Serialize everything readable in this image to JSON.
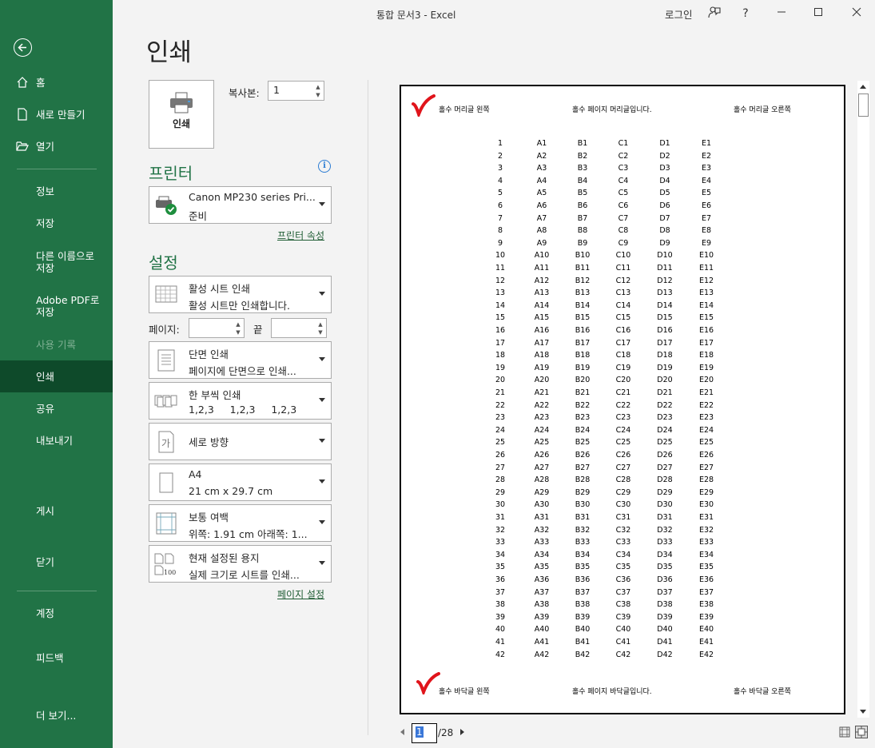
{
  "window": {
    "title": "통합 문서3  -  Excel",
    "login": "로그인",
    "help": "?"
  },
  "sidebar": {
    "items": [
      {
        "label": "홈"
      },
      {
        "label": "새로 만들기"
      },
      {
        "label": "열기"
      },
      {
        "label": "정보"
      },
      {
        "label": "저장"
      },
      {
        "label": "다른 이름으로\n저장"
      },
      {
        "label": "Adobe PDF로\n저장"
      },
      {
        "label": "사용 기록"
      },
      {
        "label": "인쇄"
      },
      {
        "label": "공유"
      },
      {
        "label": "내보내기"
      },
      {
        "label": "게시"
      },
      {
        "label": "닫기"
      },
      {
        "label": "계정"
      },
      {
        "label": "피드백"
      },
      {
        "label": "더 보기..."
      }
    ]
  },
  "print": {
    "title": "인쇄",
    "print_button": "인쇄",
    "copies_label": "복사본:",
    "copies_value": "1",
    "printer_section": "프린터",
    "printer_name": "Canon MP230 series Pri...",
    "printer_status": "준비",
    "printer_props": "프린터 속성",
    "settings_section": "설정",
    "pages_label": "페이지:",
    "end_label": "끝",
    "page_setup": "페이지 설정",
    "settings": [
      {
        "l1": "활성 시트 인쇄",
        "l2": "활성 시트만 인쇄합니다."
      },
      {
        "l1": "단면 인쇄",
        "l2": "페이지에 단면으로 인쇄..."
      },
      {
        "l1": "한 부씩 인쇄",
        "l2": "1,2,3     1,2,3     1,2,3"
      },
      {
        "l1": "세로 방향",
        "l2": ""
      },
      {
        "l1": "A4",
        "l2": "21 cm x 29.7 cm"
      },
      {
        "l1": "보통 여백",
        "l2": "위쪽: 1.91 cm 아래쪽: 1..."
      },
      {
        "l1": "현재 설정된 용지",
        "l2": "실제 크기로 시트를 인쇄..."
      }
    ]
  },
  "preview": {
    "header_left": "홀수 머리글 왼쪽",
    "header_center": "홀수 페이지 머리글입니다.",
    "header_right": "홀수 머리글 오른쪽",
    "footer_left": "홀수 바닥글 왼쪽",
    "footer_center": "홀수 페이지 바닥글입니다.",
    "footer_right": "홀수 바닥글 오른쪽",
    "columns": [
      "",
      "A",
      "B",
      "C",
      "D",
      "E"
    ],
    "row_count": 42,
    "current_page": "1",
    "total_pages": "/28",
    "check_color": "#e0141b"
  }
}
